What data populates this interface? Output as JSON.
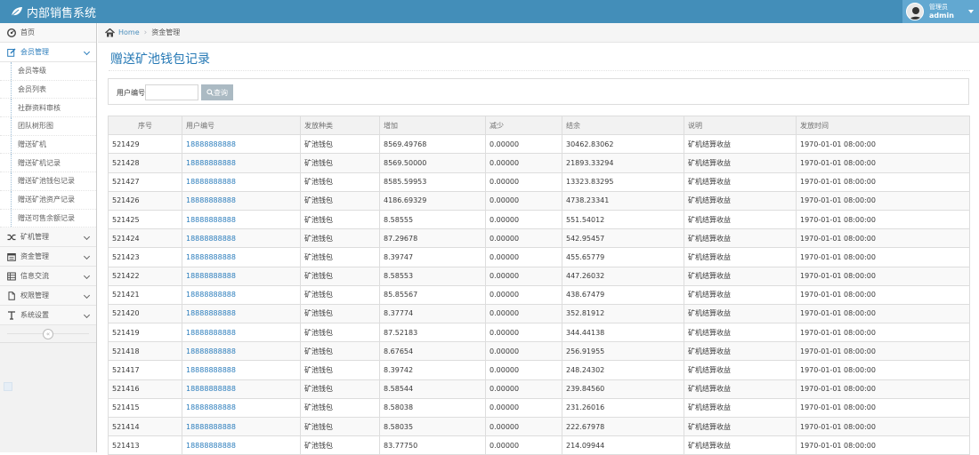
{
  "app": {
    "title": "内部销售系统"
  },
  "user": {
    "role": "管理员",
    "name": "admin"
  },
  "breadcrumb": {
    "home": "Home",
    "current": "资金管理"
  },
  "page": {
    "title": "赠送矿池钱包记录"
  },
  "search": {
    "label": "用户编号",
    "value": "",
    "placeholder": "",
    "button": "查询"
  },
  "sidebar": {
    "top_item": "首页",
    "open_group": "会员管理",
    "submenu": [
      "会员等级",
      "会员列表",
      "社群资料审核",
      "团队树形图",
      "赠送矿机",
      "赠送矿机记录",
      "赠送矿池钱包记录",
      "赠送矿池资产记录",
      "赠送可售余额记录"
    ],
    "groups": [
      {
        "label": "矿机管理",
        "icon": "shuffle-icon"
      },
      {
        "label": "资金管理",
        "icon": "calendar-icon"
      },
      {
        "label": "信息交流",
        "icon": "list-icon"
      },
      {
        "label": "权限管理",
        "icon": "file-icon"
      },
      {
        "label": "系统设置",
        "icon": "text-icon"
      }
    ],
    "collapse": "«"
  },
  "table": {
    "columns": [
      "序号",
      "用户编号",
      "发放种类",
      "增加",
      "减少",
      "结余",
      "说明",
      "发放时间"
    ],
    "rows": [
      [
        "521429",
        "18888888888",
        "矿池钱包",
        "8569.49768",
        "0.00000",
        "30462.83062",
        "矿机结算收益",
        "1970-01-01 08:00:00"
      ],
      [
        "521428",
        "18888888888",
        "矿池钱包",
        "8569.50000",
        "0.00000",
        "21893.33294",
        "矿机结算收益",
        "1970-01-01 08:00:00"
      ],
      [
        "521427",
        "18888888888",
        "矿池钱包",
        "8585.59953",
        "0.00000",
        "13323.83295",
        "矿机结算收益",
        "1970-01-01 08:00:00"
      ],
      [
        "521426",
        "18888888888",
        "矿池钱包",
        "4186.69329",
        "0.00000",
        "4738.23341",
        "矿机结算收益",
        "1970-01-01 08:00:00"
      ],
      [
        "521425",
        "18888888888",
        "矿池钱包",
        "8.58555",
        "0.00000",
        "551.54012",
        "矿机结算收益",
        "1970-01-01 08:00:00"
      ],
      [
        "521424",
        "18888888888",
        "矿池钱包",
        "87.29678",
        "0.00000",
        "542.95457",
        "矿机结算收益",
        "1970-01-01 08:00:00"
      ],
      [
        "521423",
        "18888888888",
        "矿池钱包",
        "8.39747",
        "0.00000",
        "455.65779",
        "矿机结算收益",
        "1970-01-01 08:00:00"
      ],
      [
        "521422",
        "18888888888",
        "矿池钱包",
        "8.58553",
        "0.00000",
        "447.26032",
        "矿机结算收益",
        "1970-01-01 08:00:00"
      ],
      [
        "521421",
        "18888888888",
        "矿池钱包",
        "85.85567",
        "0.00000",
        "438.67479",
        "矿机结算收益",
        "1970-01-01 08:00:00"
      ],
      [
        "521420",
        "18888888888",
        "矿池钱包",
        "8.37774",
        "0.00000",
        "352.81912",
        "矿机结算收益",
        "1970-01-01 08:00:00"
      ],
      [
        "521419",
        "18888888888",
        "矿池钱包",
        "87.52183",
        "0.00000",
        "344.44138",
        "矿机结算收益",
        "1970-01-01 08:00:00"
      ],
      [
        "521418",
        "18888888888",
        "矿池钱包",
        "8.67654",
        "0.00000",
        "256.91955",
        "矿机结算收益",
        "1970-01-01 08:00:00"
      ],
      [
        "521417",
        "18888888888",
        "矿池钱包",
        "8.39742",
        "0.00000",
        "248.24302",
        "矿机结算收益",
        "1970-01-01 08:00:00"
      ],
      [
        "521416",
        "18888888888",
        "矿池钱包",
        "8.58544",
        "0.00000",
        "239.84560",
        "矿机结算收益",
        "1970-01-01 08:00:00"
      ],
      [
        "521415",
        "18888888888",
        "矿池钱包",
        "8.58038",
        "0.00000",
        "231.26016",
        "矿机结算收益",
        "1970-01-01 08:00:00"
      ],
      [
        "521414",
        "18888888888",
        "矿池钱包",
        "8.58035",
        "0.00000",
        "222.67978",
        "矿机结算收益",
        "1970-01-01 08:00:00"
      ],
      [
        "521413",
        "18888888888",
        "矿池钱包",
        "83.77750",
        "0.00000",
        "214.09944",
        "矿机结算收益",
        "1970-01-01 08:00:00"
      ]
    ]
  },
  "colors": {
    "navbar": "#438eb9",
    "accent": "#2679b5",
    "link": "#2b7dbc"
  }
}
